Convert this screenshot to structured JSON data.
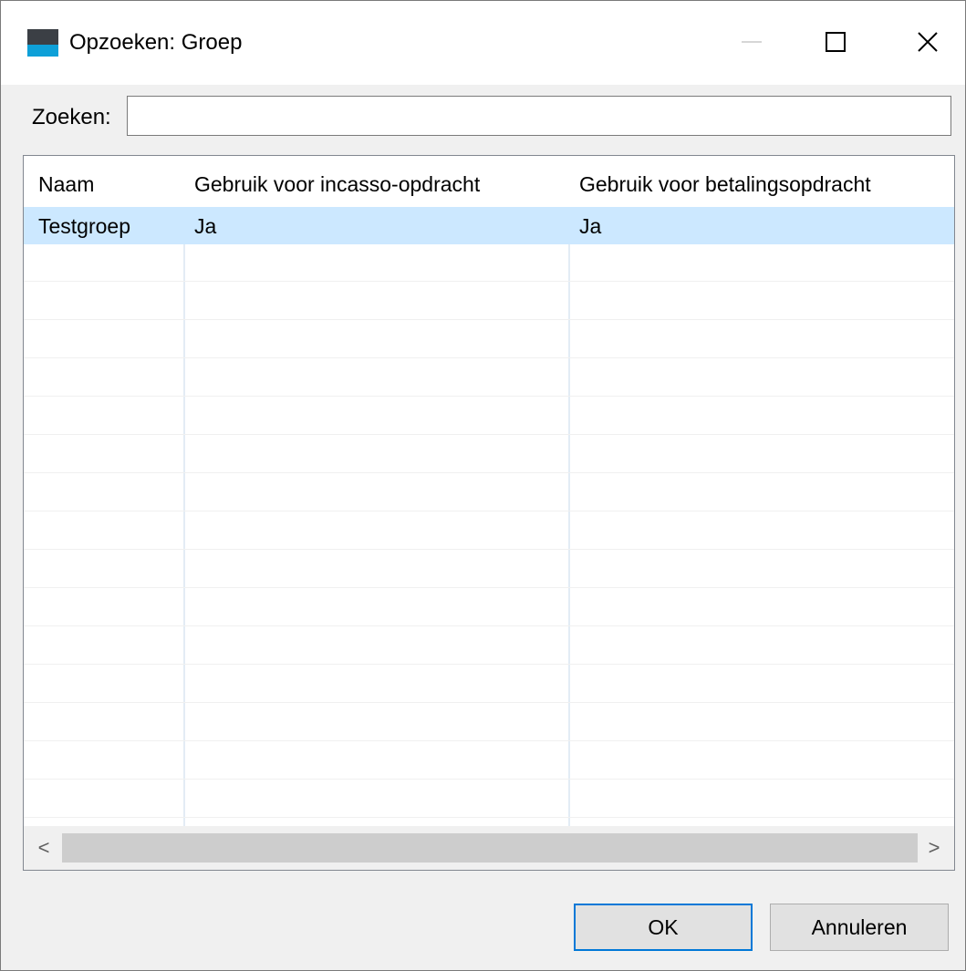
{
  "window": {
    "title": "Opzoeken: Groep",
    "controls": {
      "minimize": "minimize-icon",
      "maximize": "maximize-icon",
      "close": "close-icon"
    }
  },
  "search": {
    "label": "Zoeken:",
    "value": "",
    "placeholder": ""
  },
  "table": {
    "columns": [
      "Naam",
      "Gebruik voor incasso-opdracht",
      "Gebruik voor betalingsopdracht"
    ],
    "rows": [
      [
        "Testgroep",
        "Ja",
        "Ja"
      ]
    ],
    "selected_row": 0
  },
  "scrollbar": {
    "left_arrow": "<",
    "right_arrow": ">"
  },
  "buttons": {
    "ok": "OK",
    "cancel": "Annuleren"
  },
  "colors": {
    "accent": "#0078d7",
    "selection": "#cce8ff",
    "icon_dark": "#3b3f45",
    "icon_blue": "#0ea0d8"
  }
}
